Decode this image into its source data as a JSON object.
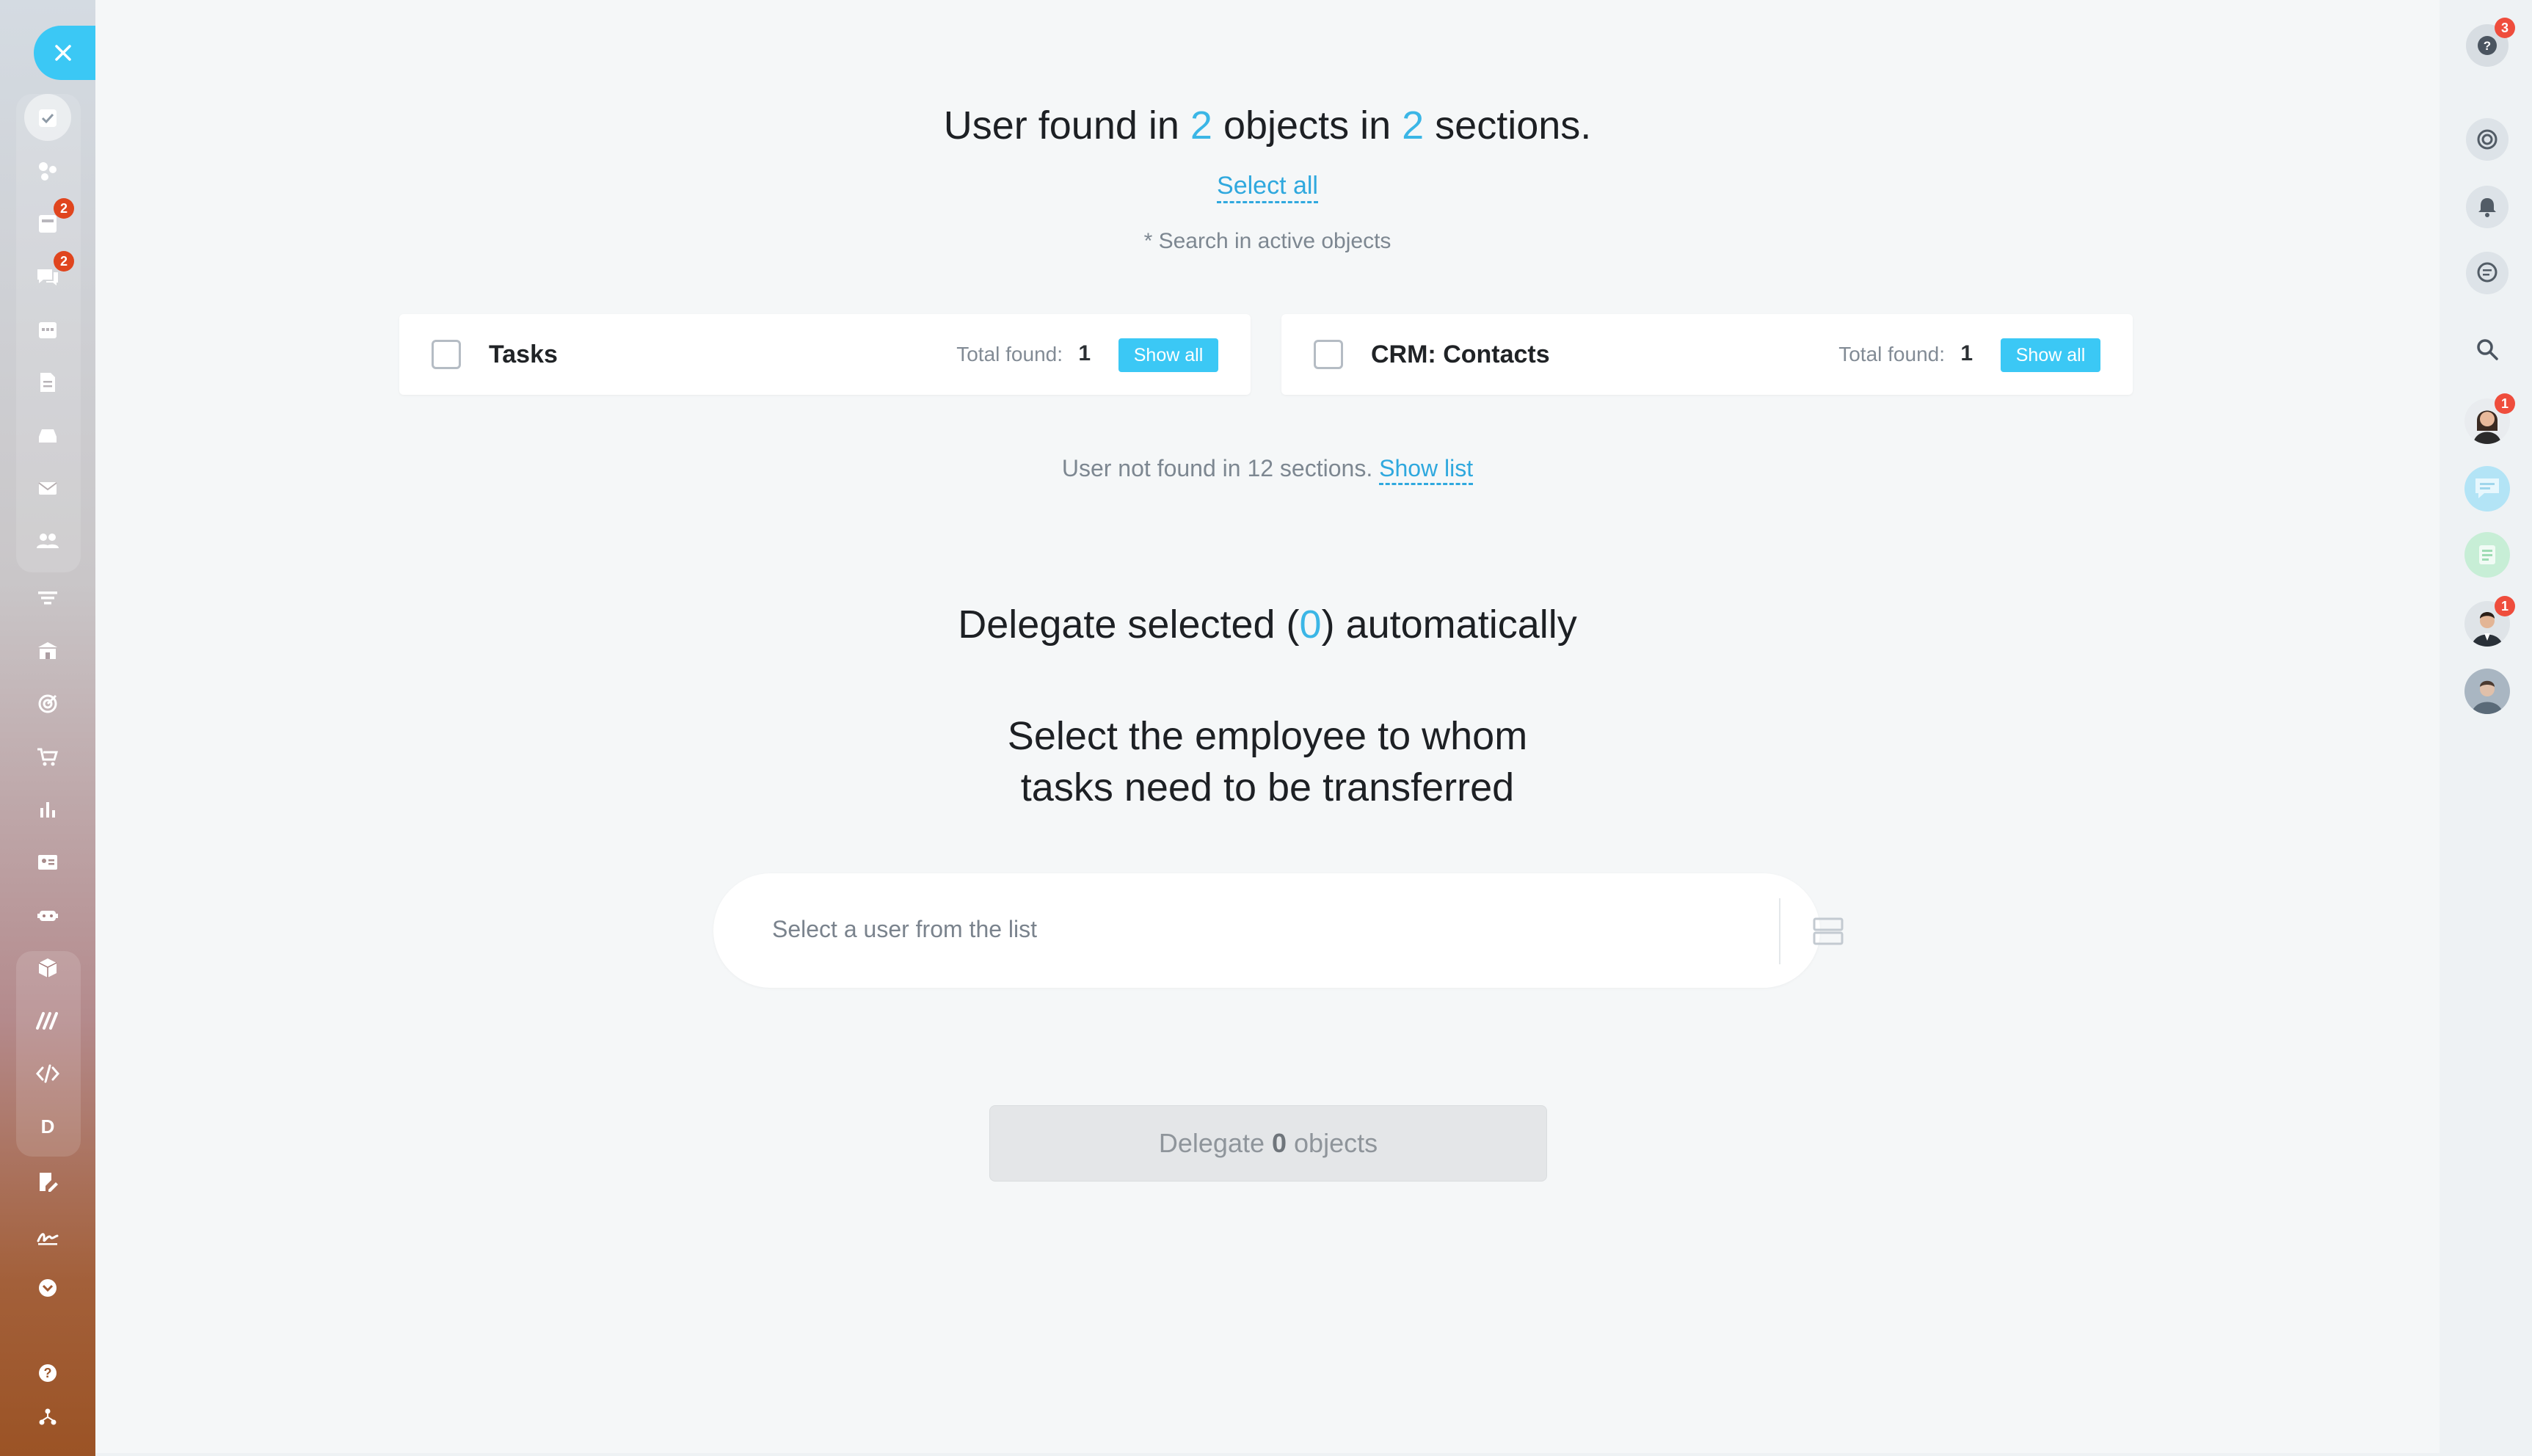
{
  "sidebar": {
    "items": [
      {
        "name": "tasks-icon",
        "badge": ""
      },
      {
        "name": "feed-icon",
        "badge": ""
      },
      {
        "name": "inbox-icon",
        "badge": "2"
      },
      {
        "name": "chat-icon",
        "badge": "2"
      },
      {
        "name": "calendar-icon",
        "badge": ""
      },
      {
        "name": "documents-icon",
        "badge": ""
      },
      {
        "name": "drive-icon",
        "badge": ""
      },
      {
        "name": "mail-icon",
        "badge": ""
      },
      {
        "name": "groups-icon",
        "badge": ""
      },
      {
        "name": "crm-filter-icon",
        "badge": ""
      },
      {
        "name": "bank-icon",
        "badge": ""
      },
      {
        "name": "target-icon",
        "badge": ""
      },
      {
        "name": "cart-icon",
        "badge": ""
      },
      {
        "name": "analytics-icon",
        "badge": ""
      },
      {
        "name": "contact-card-icon",
        "badge": ""
      },
      {
        "name": "robot-icon",
        "badge": ""
      },
      {
        "name": "box-icon",
        "badge": ""
      },
      {
        "name": "sites-icon",
        "badge": ""
      },
      {
        "name": "code-icon",
        "badge": ""
      },
      {
        "name": "d-letter",
        "badge": ""
      },
      {
        "name": "edit-doc-icon",
        "badge": ""
      },
      {
        "name": "signature-icon",
        "badge": ""
      },
      {
        "name": "more-icon",
        "badge": ""
      },
      {
        "name": "help-icon",
        "badge": ""
      },
      {
        "name": "structure-icon",
        "badge": ""
      }
    ],
    "d_letter": "D"
  },
  "summary": {
    "prefix": "User found in ",
    "objects_count": "2",
    "middle": " objects in ",
    "sections_count": "2",
    "suffix": " sections."
  },
  "select_all": "Select all",
  "search_note": "* Search in active objects",
  "sections": [
    {
      "title": "Tasks",
      "total_label": "Total found:",
      "total": "1",
      "button": "Show all"
    },
    {
      "title": "CRM: Contacts",
      "total_label": "Total found:",
      "total": "1",
      "button": "Show all"
    }
  ],
  "not_found": {
    "text": "User not found in 12 sections.",
    "link": "Show list"
  },
  "delegate_auto": {
    "prefix": "Delegate selected (",
    "count": "0",
    "suffix": ") automatically"
  },
  "select_employee": {
    "line1": "Select the employee to whom",
    "line2": "tasks need to be transferred"
  },
  "user_select": {
    "placeholder": "Select a user from the list"
  },
  "delegate_button": {
    "prefix": "Delegate",
    "count": "0",
    "suffix": "objects"
  },
  "right_bar": {
    "help_badge": "3",
    "avatar1_badge": "1",
    "avatar4_badge": "1"
  },
  "colors": {
    "accent": "#3bc8f5",
    "link": "#2fa8de",
    "badge": "#e0451e"
  }
}
